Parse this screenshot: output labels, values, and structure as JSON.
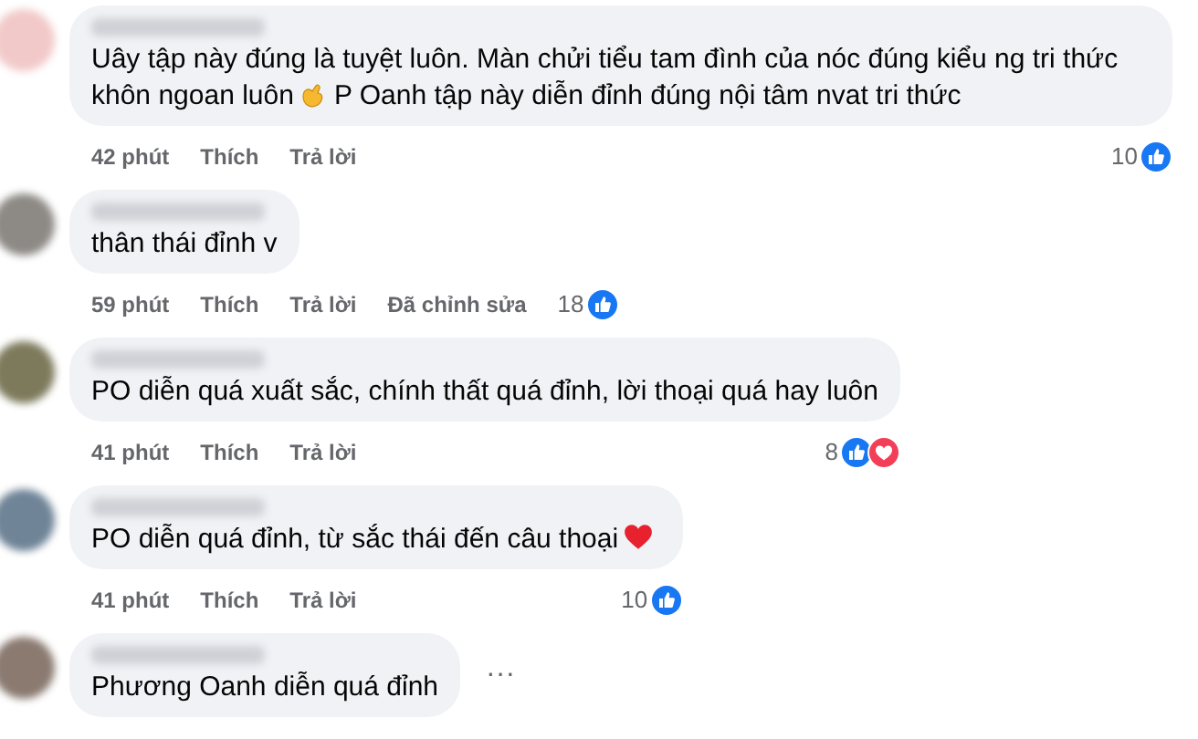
{
  "comments": [
    {
      "segments": [
        {
          "kind": "text",
          "text": "Uây tập này đúng là tuyệt luôn. Màn chửi tiểu tam đình của nóc đúng kiểu ng tri thức"
        },
        {
          "kind": "text",
          "text": "khôn ngoan luôn"
        },
        {
          "kind": "hand-emoji"
        },
        {
          "kind": "text",
          "text": "P Oanh tập này diễn đỉnh đúng nội tâm nvat tri thức"
        }
      ],
      "time": "42 phút",
      "like": "Thích",
      "reply": "Trả lời",
      "reaction_count": "10",
      "reactions": [
        {
          "kind": "like"
        }
      ]
    },
    {
      "segments": [
        {
          "kind": "text",
          "text": "thân thái đỉnh v"
        }
      ],
      "time": "59 phút",
      "like": "Thích",
      "reply": "Trả lời",
      "edited": "Đã chỉnh sửa",
      "reaction_count": "18",
      "reactions": [
        {
          "kind": "like"
        }
      ]
    },
    {
      "segments": [
        {
          "kind": "text",
          "text": "PO diễn quá xuất sắc, chính thất quá đỉnh, lời thoại quá hay luôn"
        }
      ],
      "time": "41 phút",
      "like": "Thích",
      "reply": "Trả lời",
      "reaction_count": "8",
      "reactions": [
        {
          "kind": "like"
        },
        {
          "kind": "love"
        }
      ]
    },
    {
      "segments": [
        {
          "kind": "text",
          "text": "PO diễn quá đỉnh, từ sắc thái đến câu thoại"
        },
        {
          "kind": "heart-emoji"
        }
      ],
      "time": "41 phút",
      "like": "Thích",
      "reply": "Trả lời",
      "reaction_count": "10",
      "reactions": [
        {
          "kind": "like"
        }
      ]
    },
    {
      "segments": [
        {
          "kind": "text",
          "text": "Phương Oanh diễn quá đỉnh"
        }
      ],
      "more": "···"
    }
  ]
}
